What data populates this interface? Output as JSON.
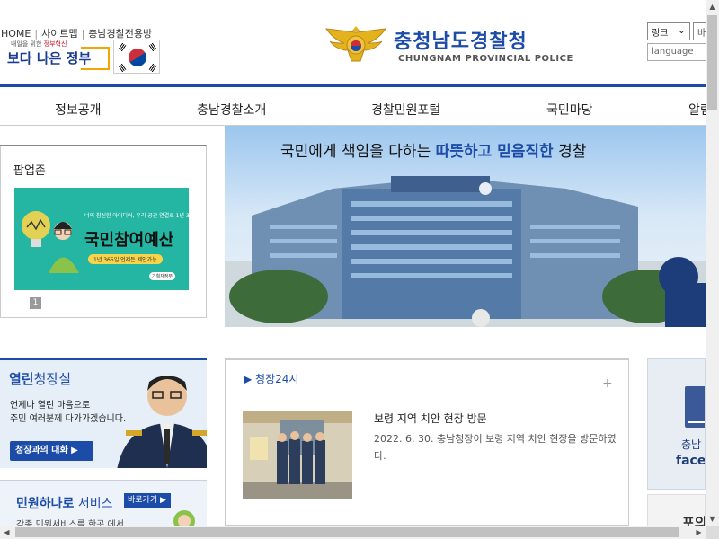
{
  "header": {
    "util_links": [
      "HOME",
      "사이트맵",
      "충남경찰전용방"
    ],
    "gov_logo": {
      "tagline_prefix": "내일을 위한",
      "tagline_accent": "정부혁신",
      "text": "보다 나은 정부"
    },
    "police_title": "충청남도경찰청",
    "police_subtitle": "CHUNGNAM PROVINCIAL POLICE",
    "link_select": "링크",
    "go_button": "바",
    "language_placeholder": "language"
  },
  "nav": {
    "items": [
      "정보공개",
      "충남경찰소개",
      "경찰민원포털",
      "국민마당",
      "알림"
    ]
  },
  "popup": {
    "title": "팝업존",
    "banner": {
      "small_text": "너의 참신한 아이디어, 우리 공간 연결로 1년 365일",
      "main_text": "국민참여예산",
      "note": "1년 365일 언제든 제안가능",
      "org": "기획재정부"
    },
    "page": "1"
  },
  "hero": {
    "headline_pre": "국민에게 책임을 다하는 ",
    "headline_em": "따뜻하고 믿음직한",
    "headline_post": " 경찰"
  },
  "chief": {
    "title_bold": "열린",
    "title_rest": "청장실",
    "text_line1": "언제나 열린 마음으로",
    "text_line2": "주민 여러분께 다가가겠습니다.",
    "button": "청장과의 대화 ▶"
  },
  "civil": {
    "title_bold": "민원하나로",
    "title_rest": " 서비스",
    "go": "바로가기 ▶",
    "desc": "각종 민원서비스를 한곳 에서"
  },
  "news": {
    "title": "▶ 청장24시",
    "headline": "보령 지역 치안 현장 방문",
    "body": "2022. 6. 30. 충남청장이 보령 지역 치안 현장을 방문하였다."
  },
  "side": {
    "fb_line1": "충남",
    "fb_line2": "face",
    "next": "포의"
  },
  "colors": {
    "brand_blue": "#1d4ca8",
    "gov_blue": "#1a3d8f",
    "fb_blue": "#3b5998",
    "teal_banner": "#24b5a3"
  },
  "icons": [
    "police-emblem-icon",
    "korean-flag-icon",
    "chevron-down-icon",
    "plus-icon",
    "facebook-icon"
  ]
}
